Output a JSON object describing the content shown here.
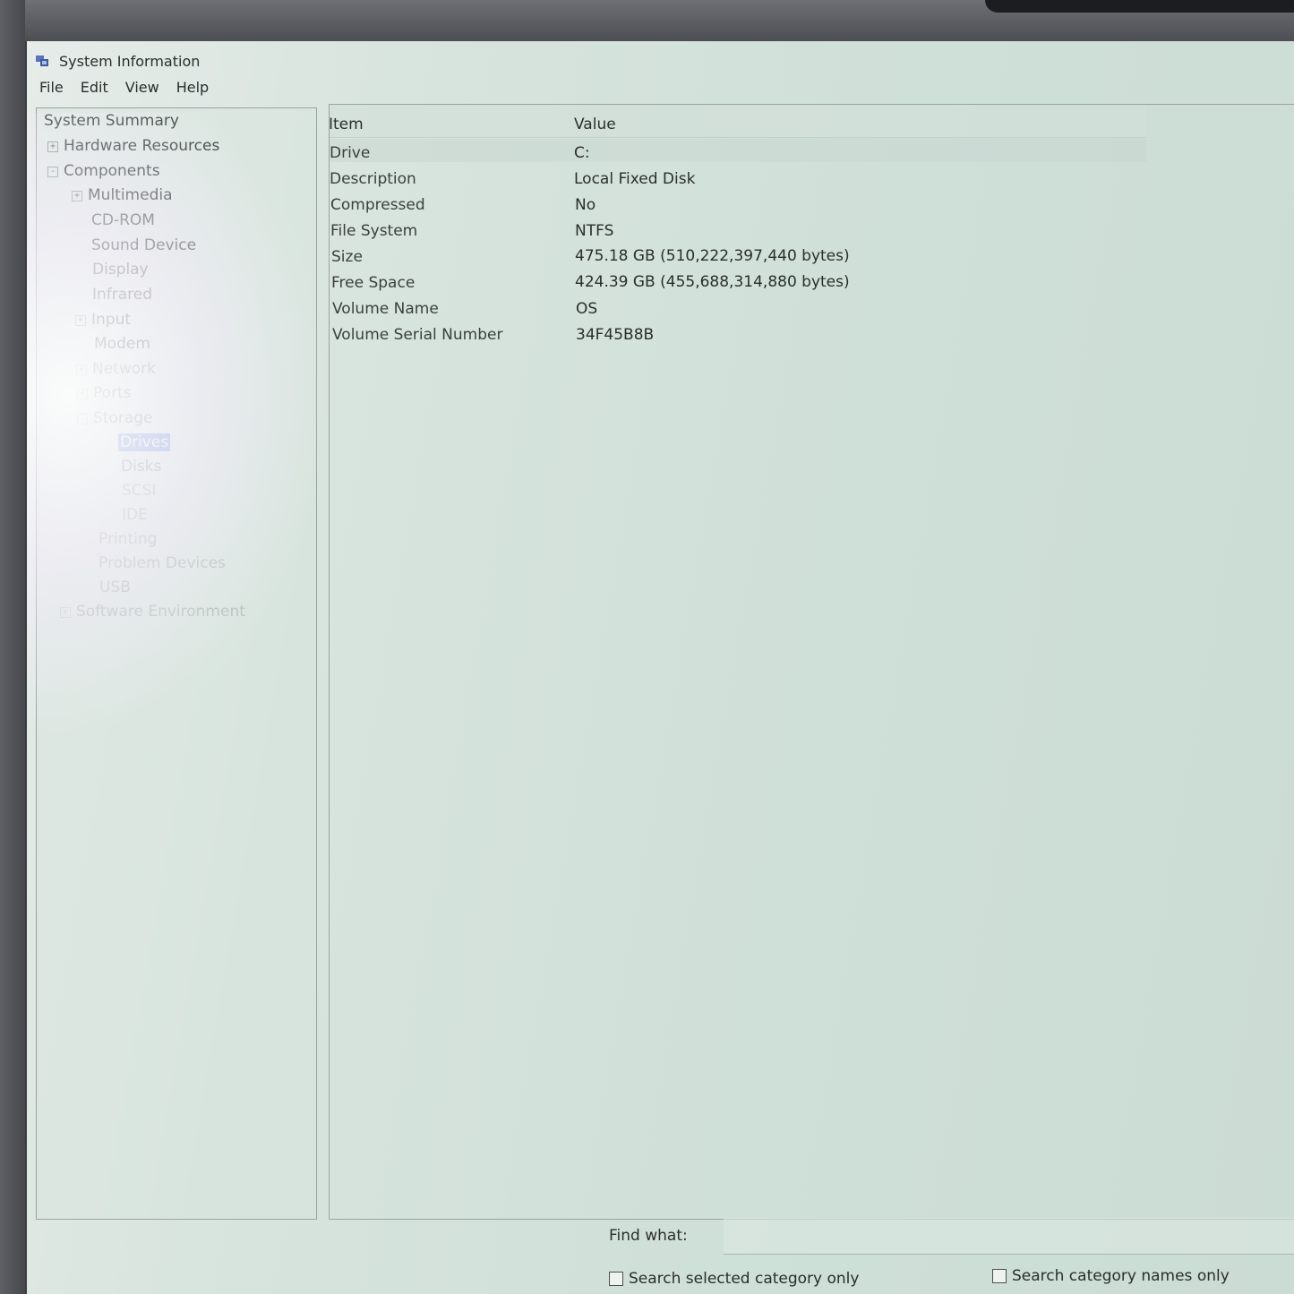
{
  "window": {
    "title": "System Information"
  },
  "menu": [
    "File",
    "Edit",
    "View",
    "Help"
  ],
  "tree": {
    "items": [
      {
        "label": "System Summary",
        "toggle": ""
      },
      {
        "label": "Hardware Resources",
        "toggle": "+"
      },
      {
        "label": "Components",
        "toggle": "-"
      },
      {
        "label": "Multimedia",
        "toggle": "+"
      },
      {
        "label": "CD-ROM",
        "toggle": ""
      },
      {
        "label": "Sound Device",
        "toggle": ""
      },
      {
        "label": "Display",
        "toggle": ""
      },
      {
        "label": "Infrared",
        "toggle": ""
      },
      {
        "label": "Input",
        "toggle": "+"
      },
      {
        "label": "Modem",
        "toggle": ""
      },
      {
        "label": "Network",
        "toggle": "+"
      },
      {
        "label": "Ports",
        "toggle": "+"
      },
      {
        "label": "Storage",
        "toggle": "-"
      },
      {
        "label": "Drives",
        "toggle": ""
      },
      {
        "label": "Disks",
        "toggle": ""
      },
      {
        "label": "SCSI",
        "toggle": ""
      },
      {
        "label": "IDE",
        "toggle": ""
      },
      {
        "label": "Printing",
        "toggle": ""
      },
      {
        "label": "Problem Devices",
        "toggle": ""
      },
      {
        "label": "USB",
        "toggle": ""
      },
      {
        "label": "Software Environment",
        "toggle": "+"
      }
    ]
  },
  "details": {
    "headers": {
      "item": "Item",
      "value": "Value"
    },
    "rows": [
      {
        "item": "Drive",
        "value": "C:"
      },
      {
        "item": "Description",
        "value": "Local Fixed Disk"
      },
      {
        "item": "Compressed",
        "value": "No"
      },
      {
        "item": "File System",
        "value": "NTFS"
      },
      {
        "item": "Size",
        "value": "475.18 GB (510,222,397,440 bytes)"
      },
      {
        "item": "Free Space",
        "value": "424.39 GB (455,688,314,880 bytes)"
      },
      {
        "item": "Volume Name",
        "value": "OS"
      },
      {
        "item": "Volume Serial Number",
        "value": "34F45B8B"
      }
    ]
  },
  "find": {
    "label": "Find what:",
    "value": "",
    "search_selected_label": "Search selected category only",
    "search_names_label": "Search category names only"
  }
}
